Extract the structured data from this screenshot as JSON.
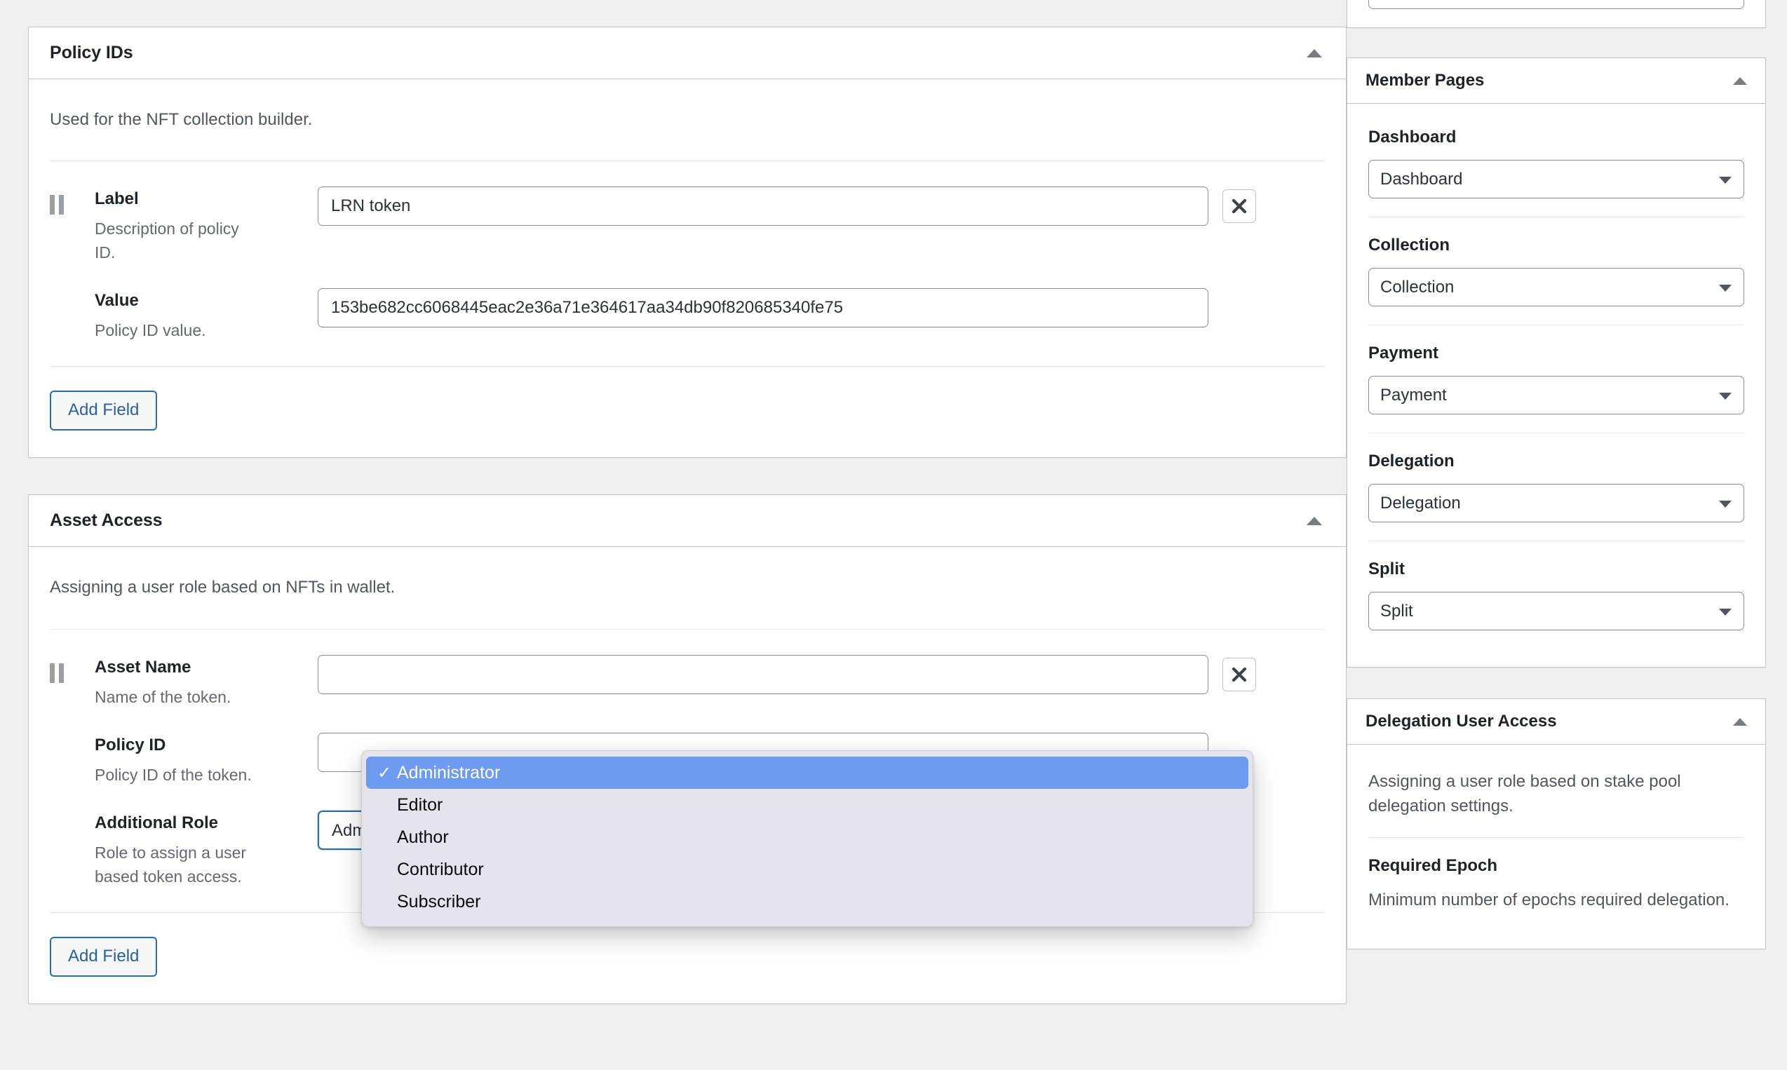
{
  "main": {
    "panels": [
      {
        "id": "policy-ids",
        "title": "Policy IDs",
        "description": "Used for the NFT collection builder.",
        "add_button": "Add Field",
        "fields": [
          {
            "label": "Label",
            "help": "Description of policy ID.",
            "value": "LRN token",
            "placeholder": "",
            "type": "text",
            "has_handle": true,
            "has_remove": true
          },
          {
            "label": "Value",
            "help": "Policy ID value.",
            "value": "153be682cc6068445eac2e36a71e364617aa34db90f820685340fe75",
            "placeholder": "",
            "type": "text",
            "has_handle": false,
            "has_remove": false
          }
        ]
      },
      {
        "id": "asset-access",
        "title": "Asset Access",
        "description": "Assigning a user role based on NFTs in wallet.",
        "add_button": "Add Field",
        "fields": [
          {
            "label": "Asset Name",
            "help": "Name of the token.",
            "value": "",
            "placeholder": "",
            "type": "text",
            "has_handle": true,
            "has_remove": true
          },
          {
            "label": "Policy ID",
            "help": "Policy ID of the token.",
            "value": "",
            "placeholder": "",
            "type": "text",
            "has_handle": false,
            "has_remove": false
          },
          {
            "label": "Additional Role",
            "help": "Role to assign a user based token access.",
            "value": "Administrator",
            "placeholder": "",
            "type": "select",
            "has_handle": false,
            "has_remove": false
          }
        ]
      }
    ]
  },
  "role_dropdown": {
    "open": true,
    "selected": "Administrator",
    "check_glyph": "✓",
    "highlight_color": "#6d9bef",
    "background_color": "#e5e3ec",
    "options": [
      "Administrator",
      "Editor",
      "Author",
      "Contributor",
      "Subscriber"
    ]
  },
  "sidebar": {
    "top_panel": {
      "input_value": "",
      "input_placeholder": ""
    },
    "member_pages": {
      "title": "Member Pages",
      "fields": [
        {
          "label": "Dashboard",
          "value": "Dashboard"
        },
        {
          "label": "Collection",
          "value": "Collection"
        },
        {
          "label": "Payment",
          "value": "Payment"
        },
        {
          "label": "Delegation",
          "value": "Delegation"
        },
        {
          "label": "Split",
          "value": "Split"
        }
      ]
    },
    "delegation_user_access": {
      "title": "Delegation User Access",
      "description": "Assigning a user role based on stake pool delegation settings.",
      "fields": [
        {
          "label": "Required Epoch",
          "help": "Minimum number of epochs required delegation."
        }
      ]
    }
  },
  "icons": {
    "collapse": "caret-up-icon",
    "remove": "close-x-icon",
    "drag": "drag-handle-icon",
    "select_caret": "caret-down-icon"
  },
  "colors": {
    "accent_blue": "#2d6aa8",
    "highlight_blue": "#6d9bef",
    "panel_border": "#c3c4c7",
    "page_background": "#f0f0f1"
  }
}
